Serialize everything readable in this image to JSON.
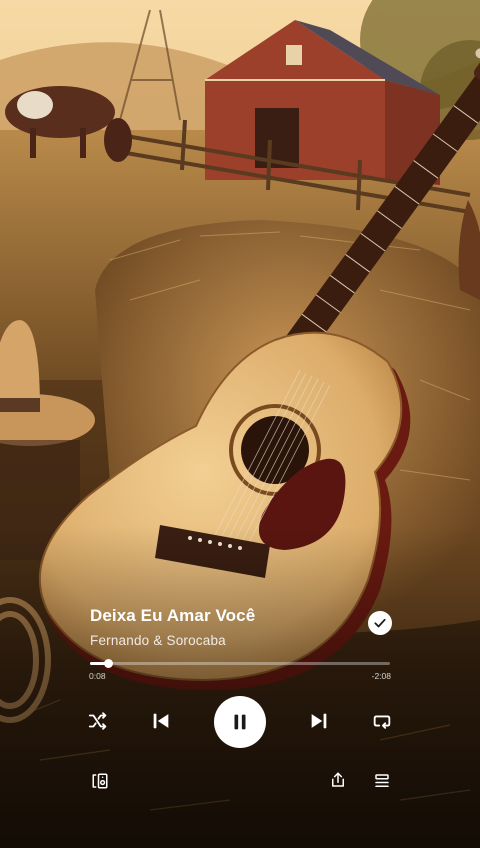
{
  "track": {
    "title": "Deixa Eu Amar Você",
    "artist": "Fernando & Sorocaba",
    "saved": true
  },
  "playback": {
    "elapsed": "0:08",
    "remaining": "-2:08",
    "progress_fraction": 0.06,
    "state": "playing"
  },
  "controls": {
    "shuffle_icon": "shuffle-icon",
    "previous_icon": "skip-previous-icon",
    "pause_icon": "pause-icon",
    "next_icon": "skip-next-icon",
    "repeat_icon": "repeat-icon"
  },
  "footer": {
    "device_icon": "connect-device-icon",
    "share_icon": "share-icon",
    "queue_icon": "queue-icon"
  },
  "colors": {
    "accent": "#ffffff",
    "progress_track": "rgba(255,255,255,0.35)",
    "icon_dark": "#1a1a1a"
  }
}
